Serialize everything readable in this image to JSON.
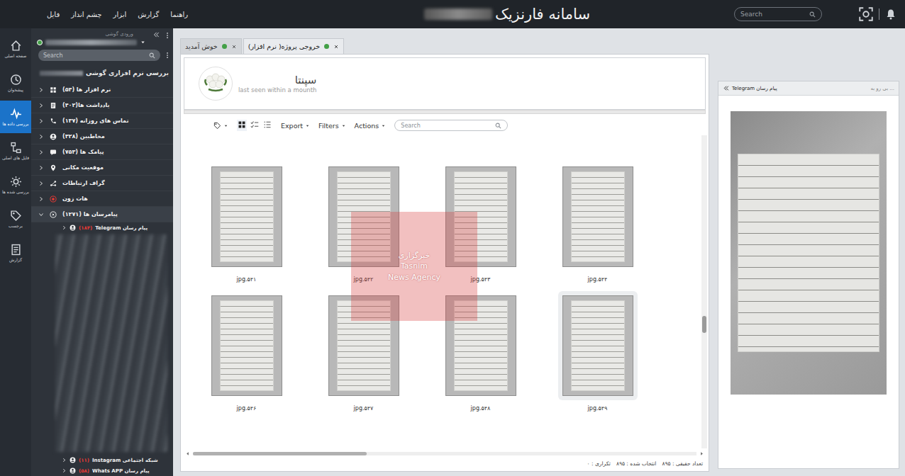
{
  "window": {
    "title": "سامانه فارنزیک"
  },
  "menu": [
    "فایل",
    "چشم انداز",
    "ابزار",
    "گزارش",
    "راهنما"
  ],
  "top_search": {
    "placeholder": "Search"
  },
  "rail": [
    {
      "label": "صفحه اصلی",
      "selected": false
    },
    {
      "label": "پیشخوان",
      "selected": false
    },
    {
      "label": "بررسی داده ها",
      "selected": true
    },
    {
      "label": "فایل های اصلی",
      "selected": false
    },
    {
      "label": "بررسی شده ها",
      "selected": false
    },
    {
      "label": "برچسب",
      "selected": false
    },
    {
      "label": "گزارش",
      "selected": false
    }
  ],
  "device": {
    "label": "ورودی گوشی",
    "online": true
  },
  "tree_search": {
    "placeholder": "Search"
  },
  "tree_title": "بررسی نرم افزاری گوشی",
  "tree": [
    {
      "label": "نرم افزار ها (۵۴)",
      "expanded": false
    },
    {
      "label": "یادداشت ها(۴۰۲)",
      "expanded": false
    },
    {
      "label": "تماس های روزانه (۱۳۷)",
      "expanded": false
    },
    {
      "label": "مخاطبین (۳۲۸)",
      "expanded": false
    },
    {
      "label": "پیامک ها (۷۵۳)",
      "expanded": false
    },
    {
      "label": "موقعیت مکانی",
      "expanded": false
    },
    {
      "label": "گراف ارتباطات",
      "expanded": false
    },
    {
      "label": "هات زون",
      "expanded": false
    },
    {
      "label": "پیامرسان ها (۱۲۷۱)",
      "expanded": true
    }
  ],
  "tree_children": [
    {
      "label": "پیام رسان Telegram",
      "count": "(۱۸۴)"
    }
  ],
  "tree_bottom": [
    {
      "label": "شبکه اجتماعی Instagram",
      "count": "(۱۱)"
    },
    {
      "label": "پیام رسان Whats APP",
      "count": "(۵۸)"
    }
  ],
  "tabs": [
    {
      "label": "خوش آمدید",
      "selected": false
    },
    {
      "label": "خروجی پروژه( نرم افزار)",
      "selected": true
    }
  ],
  "profile": {
    "name": "سپنتا",
    "status": "last seen within a mounth"
  },
  "toolbar": {
    "views": [
      {
        "selected": true
      },
      {
        "selected": false
      },
      {
        "selected": false
      }
    ],
    "buttons": [
      "Export",
      "Filters",
      "Actions"
    ],
    "search": {
      "placeholder": "Search"
    }
  },
  "images": [
    {
      "label": "jpg.۵۴۱",
      "selected": false
    },
    {
      "label": "jpg.۵۴۲",
      "selected": false
    },
    {
      "label": "jpg.۵۴۳",
      "selected": false
    },
    {
      "label": "jpg.۵۴۴",
      "selected": false
    },
    {
      "label": "jpg.۵۴۶",
      "selected": false
    },
    {
      "label": "jpg.۵۴۷",
      "selected": false
    },
    {
      "label": "jpg.۵۴۸",
      "selected": false
    },
    {
      "label": "jpg.۵۴۹",
      "selected": true
    }
  ],
  "watermark": {
    "lines": [
      "خبرگزاری",
      "Tasnim",
      "News Agency"
    ]
  },
  "status": [
    "تعداد حقیقی : ۸۹۵",
    "انتخاب شده : ۸۹۵",
    "تکراری : ۰"
  ],
  "preview": {
    "title": "پیام رسان Telegram",
    "crumb": "... بی رو به"
  }
}
